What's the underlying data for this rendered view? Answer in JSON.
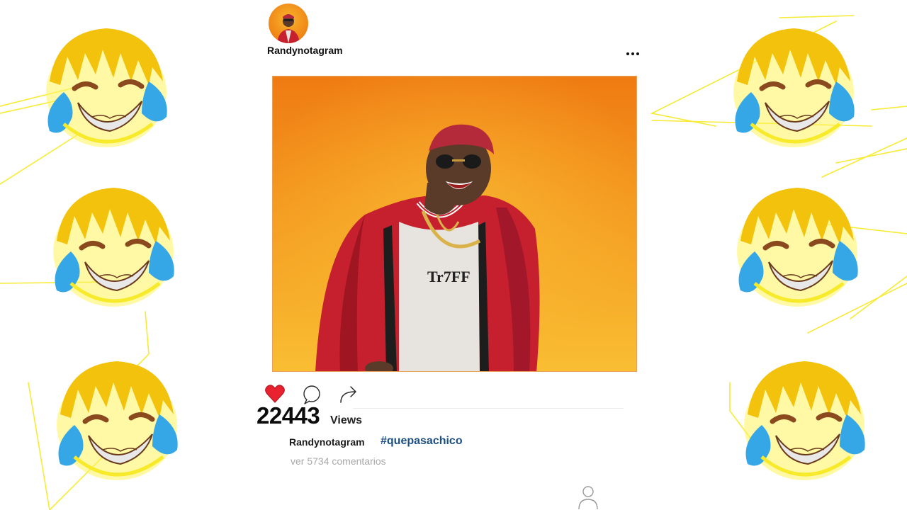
{
  "post": {
    "username": "Randynotagram",
    "views_count": "22443",
    "views_label": "Views",
    "caption_user": "Randynotagram",
    "hashtag": "#quepasachico",
    "comments_link": "ver 5734 comentarios",
    "liked": true
  },
  "icons": {
    "more": "more-dots-icon",
    "like": "heart-icon",
    "comment": "comment-bubble-icon",
    "share": "share-arrow-icon",
    "profile": "profile-icon"
  },
  "colors": {
    "like_red": "#e8232f",
    "hashtag_blue": "#1d4f82",
    "photo_orange_top": "#f07d14",
    "photo_orange_bottom": "#f8b52c",
    "jacket_red": "#c6202e",
    "scribble_yellow": "#f7e61a",
    "emoji_tear_blue": "#35a7e6"
  },
  "decor": {
    "emoji_name": "laughing-crying-face-icon"
  }
}
